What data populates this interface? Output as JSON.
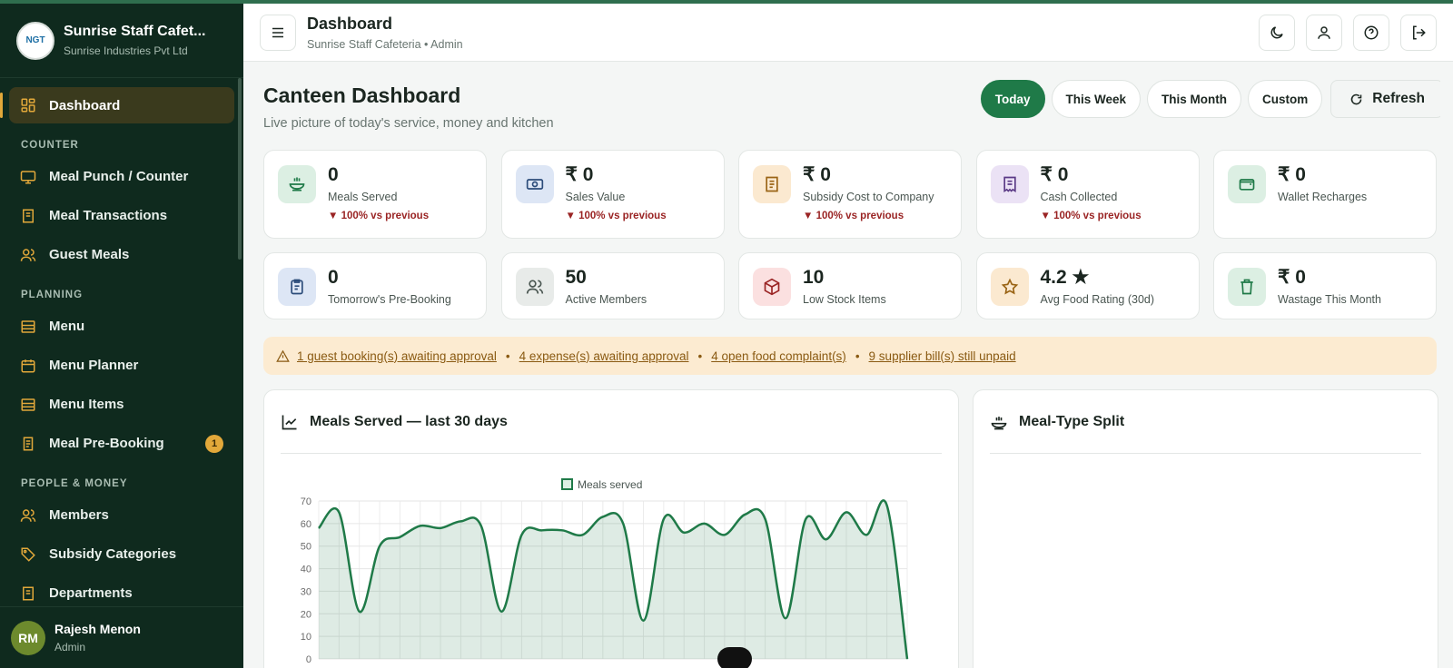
{
  "app": {
    "name": "Sunrise Staff Cafet...",
    "company": "Sunrise Industries Pvt Ltd",
    "logo_text": "NGT"
  },
  "sidebar": {
    "dashboard": "Dashboard",
    "sections": [
      {
        "title": "COUNTER",
        "items": [
          "Meal Punch / Counter",
          "Meal Transactions",
          "Guest Meals"
        ]
      },
      {
        "title": "PLANNING",
        "items": [
          "Menu",
          "Menu Planner",
          "Menu Items",
          "Meal Pre-Booking"
        ]
      },
      {
        "title": "PEOPLE & MONEY",
        "items": [
          "Members",
          "Subsidy Categories",
          "Departments"
        ]
      }
    ],
    "prebooking_badge": "1",
    "user": {
      "initials": "RM",
      "name": "Rajesh Menon",
      "role": "Admin"
    }
  },
  "header": {
    "title": "Dashboard",
    "subtitle": "Sunrise Staff Cafeteria • Admin"
  },
  "page": {
    "title": "Canteen Dashboard",
    "subtitle": "Live picture of today's service, money and kitchen",
    "filters": [
      "Today",
      "This Week",
      "This Month",
      "Custom"
    ],
    "refresh": "Refresh"
  },
  "stats": [
    {
      "value": "0",
      "label": "Meals Served",
      "trend": "▼ 100% vs previous"
    },
    {
      "value": "₹ 0",
      "label": "Sales Value",
      "trend": "▼ 100% vs previous"
    },
    {
      "value": "₹ 0",
      "label": "Subsidy Cost to Company",
      "trend": "▼ 100% vs previous"
    },
    {
      "value": "₹ 0",
      "label": "Cash Collected",
      "trend": "▼ 100% vs previous"
    },
    {
      "value": "₹ 0",
      "label": "Wallet Recharges"
    },
    {
      "value": "0",
      "label": "Tomorrow's Pre-Booking"
    },
    {
      "value": "50",
      "label": "Active Members"
    },
    {
      "value": "10",
      "label": "Low Stock Items"
    },
    {
      "value": "4.2 ★",
      "label": "Avg Food Rating (30d)"
    },
    {
      "value": "₹ 0",
      "label": "Wastage This Month"
    }
  ],
  "alerts": [
    "1 guest booking(s) awaiting approval",
    "4 expense(s) awaiting approval",
    "4 open food complaint(s)",
    "9 supplier bill(s) still unpaid"
  ],
  "panels": {
    "meals_chart_title": "Meals Served — last 30 days",
    "split_title": "Meal-Type Split"
  },
  "colors": {
    "accent": "#1f7a48",
    "sidebar": "#0f2a1e",
    "highlight": "#e2a83a"
  },
  "chart_data": {
    "type": "line",
    "title": "Meals Served — last 30 days",
    "series": [
      {
        "name": "Meals served",
        "values": [
          58,
          65,
          21,
          50,
          54,
          59,
          58,
          61,
          59,
          21,
          55,
          57,
          57,
          55,
          63,
          60,
          17,
          62,
          56,
          60,
          55,
          64,
          62,
          18,
          62,
          53,
          65,
          55,
          68,
          0
        ]
      }
    ],
    "ylim": [
      0,
      70
    ],
    "yticks": [
      0,
      10,
      20,
      30,
      40,
      50,
      60,
      70
    ],
    "grid": true,
    "legend": "top"
  }
}
